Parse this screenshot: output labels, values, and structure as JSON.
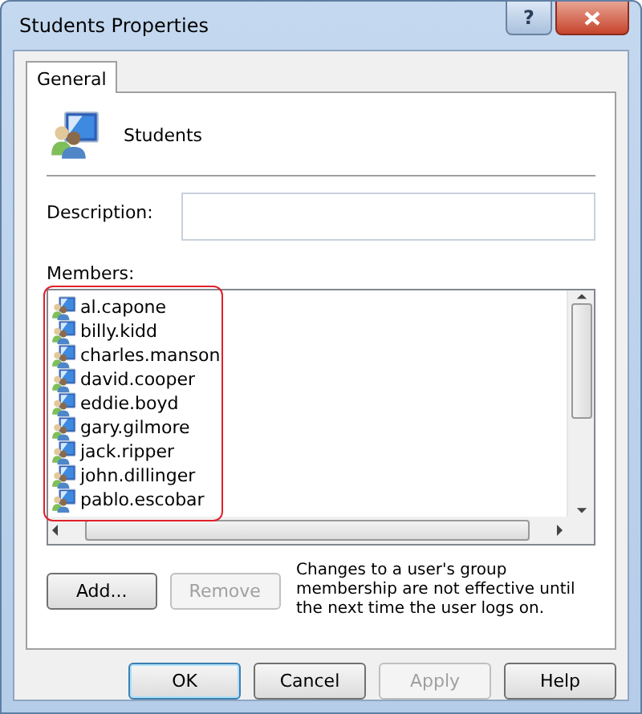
{
  "window": {
    "title": "Students Properties",
    "help_glyph": "?"
  },
  "tabs": [
    {
      "label": "General",
      "selected": true
    }
  ],
  "group_name": "Students",
  "description": {
    "label": "Description:"
  },
  "members": {
    "label": "Members:",
    "items": [
      {
        "name": "al.capone"
      },
      {
        "name": "billy.kidd"
      },
      {
        "name": "charles.manson"
      },
      {
        "name": "david.cooper"
      },
      {
        "name": "eddie.boyd"
      },
      {
        "name": "gary.gilmore"
      },
      {
        "name": "jack.ripper"
      },
      {
        "name": "john.dillinger"
      },
      {
        "name": "pablo.escobar"
      }
    ]
  },
  "member_buttons": [
    {
      "label": "Add...",
      "disabled": false
    },
    {
      "label": "Remove",
      "disabled": true
    }
  ],
  "note": "Changes to a user's group membership are not effective until the next time the user logs on.",
  "dialog_buttons": [
    {
      "label": "OK",
      "default": true,
      "disabled": false
    },
    {
      "label": "Cancel",
      "default": false,
      "disabled": false
    },
    {
      "label": "Apply",
      "default": false,
      "disabled": true
    },
    {
      "label": "Help",
      "default": false,
      "disabled": false
    }
  ]
}
